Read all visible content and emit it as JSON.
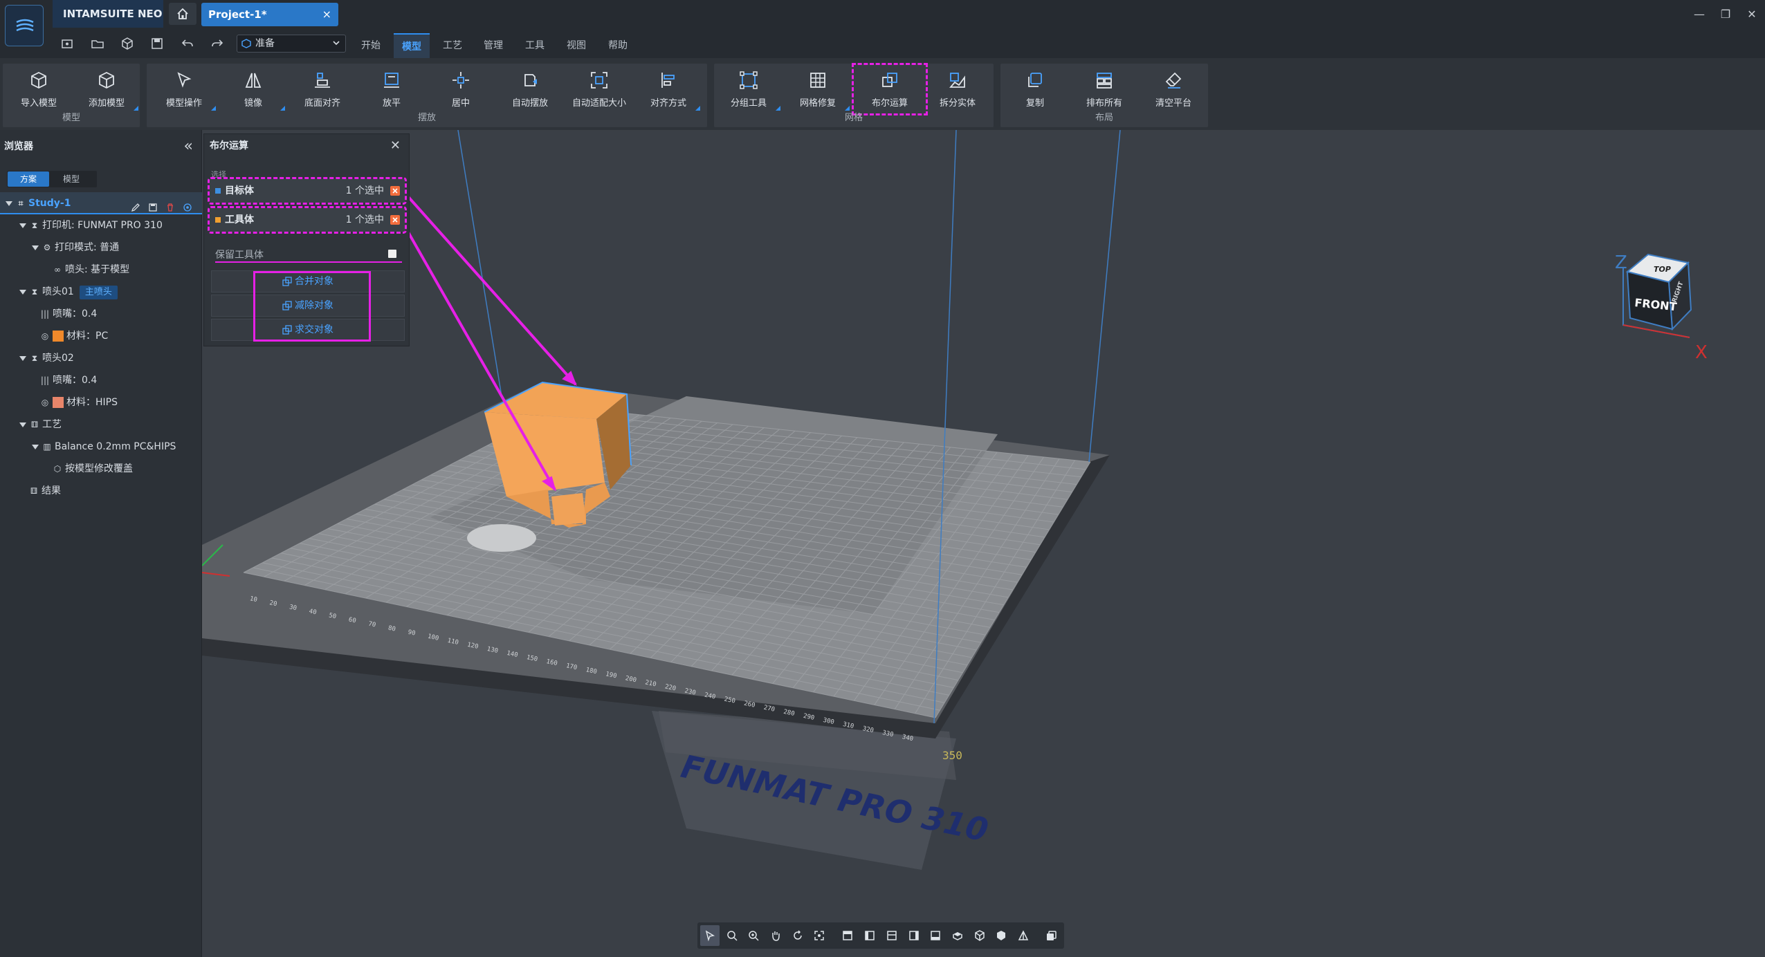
{
  "app": {
    "brand": "INTAMSUITE NEO",
    "project_tab": "Project-1*",
    "tab_close": "×"
  },
  "window_controls": {
    "minimize": "—",
    "restore": "❐",
    "close": "✕"
  },
  "quickbar": {
    "mode_value": "准备"
  },
  "menu": [
    {
      "label": "开始"
    },
    {
      "label": "模型"
    },
    {
      "label": "工艺"
    },
    {
      "label": "管理"
    },
    {
      "label": "工具"
    },
    {
      "label": "视图"
    },
    {
      "label": "帮助"
    }
  ],
  "ribbon": {
    "groups": [
      {
        "title": "模型",
        "buttons": [
          {
            "label": "导入模型"
          },
          {
            "label": "添加模型"
          }
        ]
      },
      {
        "title": "摆放",
        "buttons": [
          {
            "label": "模型操作"
          },
          {
            "label": "镜像"
          },
          {
            "label": "底面对齐"
          },
          {
            "label": "放平"
          },
          {
            "label": "居中"
          },
          {
            "label": "自动摆放"
          },
          {
            "label": "自动适配大小"
          },
          {
            "label": "对齐方式"
          }
        ]
      },
      {
        "title": "网格",
        "buttons": [
          {
            "label": "分组工具"
          },
          {
            "label": "网格修复"
          },
          {
            "label": "布尔运算"
          },
          {
            "label": "拆分实体"
          }
        ]
      },
      {
        "title": "布局",
        "buttons": [
          {
            "label": "复制"
          },
          {
            "label": "排布所有"
          },
          {
            "label": "清空平台"
          }
        ]
      }
    ]
  },
  "browser": {
    "title": "浏览器",
    "collapse": "«",
    "tabs": [
      {
        "label": "方案"
      },
      {
        "label": "模型"
      }
    ],
    "tree": [
      {
        "label": "Study-1"
      },
      {
        "label": "打印机: FUNMAT PRO 310"
      },
      {
        "label": "打印模式: 普通"
      },
      {
        "label": "喷头: 基于模型"
      },
      {
        "label": "喷头01",
        "badge": "主喷头"
      },
      {
        "label": "喷嘴：0.4"
      },
      {
        "label": "材料：PC",
        "color": "#f0892b"
      },
      {
        "label": "喷头02"
      },
      {
        "label": "喷嘴：0.4"
      },
      {
        "label": "材料：HIPS",
        "color": "#e8856a"
      },
      {
        "label": "工艺"
      },
      {
        "label": "Balance 0.2mm PC&HIPS"
      },
      {
        "label": "按模型修改覆盖"
      },
      {
        "label": "结果"
      }
    ]
  },
  "boolean_panel": {
    "title": "布尔运算",
    "close": "✕",
    "section": "选择",
    "target": {
      "label": "目标体",
      "count": "1 个选中",
      "color": "#3d8fe0"
    },
    "tool": {
      "label": "工具体",
      "count": "1 个选中",
      "color": "#f0a030"
    },
    "keep_tool": "保留工具体",
    "ops": [
      {
        "label": "合并对象"
      },
      {
        "label": "减除对象"
      },
      {
        "label": "求交对象"
      }
    ]
  },
  "viewport": {
    "printer_label": "FUNMAT PRO 310",
    "ruler_ticks": [
      "10",
      "20",
      "30",
      "40",
      "50",
      "60",
      "70",
      "80",
      "90",
      "100",
      "110",
      "120",
      "130",
      "140",
      "150",
      "160",
      "170",
      "180",
      "190",
      "200",
      "210",
      "220",
      "230",
      "240",
      "250",
      "260",
      "270",
      "280",
      "290",
      "300",
      "310",
      "320",
      "330",
      "340"
    ],
    "ruler_end": "350",
    "view_cube": {
      "top": "TOP",
      "front": "FRONT",
      "right": "RIGHT",
      "axis_x": "X",
      "axis_z": "Z"
    }
  },
  "colors": {
    "accent": "#2f8ef0",
    "highlight": "#e620e6",
    "model_orange": "#f4a559",
    "model_shadow": "#9a6630"
  }
}
